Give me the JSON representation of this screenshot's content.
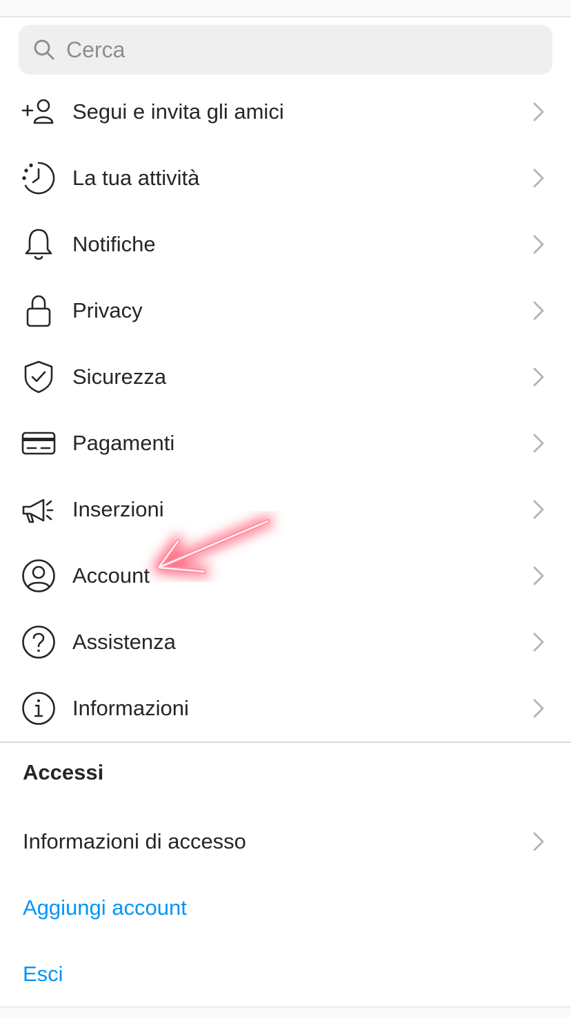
{
  "search": {
    "placeholder": "Cerca",
    "icon": "search-icon"
  },
  "menu": {
    "items": [
      {
        "label": "Segui e invita gli amici",
        "icon": "add-person-icon"
      },
      {
        "label": "La tua attività",
        "icon": "activity-clock-icon"
      },
      {
        "label": "Notifiche",
        "icon": "bell-icon"
      },
      {
        "label": "Privacy",
        "icon": "lock-icon"
      },
      {
        "label": "Sicurezza",
        "icon": "shield-check-icon"
      },
      {
        "label": "Pagamenti",
        "icon": "credit-card-icon"
      },
      {
        "label": "Inserzioni",
        "icon": "megaphone-icon"
      },
      {
        "label": "Account",
        "icon": "person-circle-icon"
      },
      {
        "label": "Assistenza",
        "icon": "help-circle-icon"
      },
      {
        "label": "Informazioni",
        "icon": "info-circle-icon"
      }
    ]
  },
  "logins": {
    "title": "Accessi",
    "login_info": "Informazioni di accesso",
    "add_account": "Aggiungi account",
    "logout": "Esci"
  },
  "colors": {
    "text": "#262626",
    "muted": "#8e8e8e",
    "link": "#0095f6",
    "search_bg": "#efefef",
    "annotation_arrow": "#ff3b5c"
  }
}
